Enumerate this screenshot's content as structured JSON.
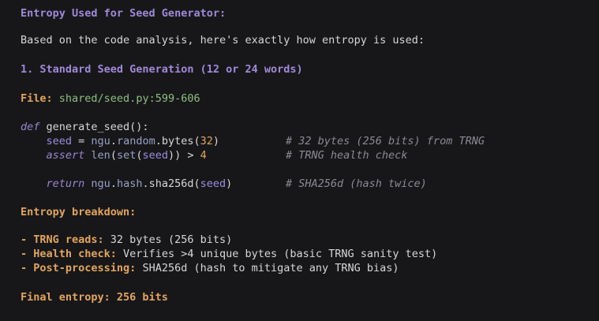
{
  "heading": "Entropy Used for Seed Generator:",
  "intro": "Based on the code analysis, here's exactly how entropy is used:",
  "section_title": "1. Standard Seed Generation (12 or 24 words)",
  "file_label": "File:",
  "file_path": "shared/seed.py:599-606",
  "code": {
    "def_kw": "def",
    "func_sig": " generate_seed():",
    "l1_var": "seed",
    "l1_eq": " = ",
    "l1_mod": "ngu",
    "l1_dot1": ".",
    "l1_attr1": "random",
    "l1_dot2": ".",
    "l1_attr2": "bytes",
    "l1_open": "(",
    "l1_num": "32",
    "l1_close": ")",
    "l1_comment": "# 32 bytes (256 bits) from TRNG",
    "l2_kw": "assert",
    "l2_len": " len",
    "l2_p1": "(",
    "l2_set": "set",
    "l2_p2": "(",
    "l2_var": "seed",
    "l2_p3": ")) > ",
    "l2_num": "4",
    "l2_comment": "# TRNG health check",
    "l3_kw": "return",
    "l3_mod": " ngu",
    "l3_dot1": ".",
    "l3_attr1": "hash",
    "l3_dot2": ".",
    "l3_attr2": "sha256d",
    "l3_p1": "(",
    "l3_var": "seed",
    "l3_p2": ")",
    "l3_comment": "# SHA256d (hash twice)"
  },
  "breakdown_title": "Entropy breakdown:",
  "breakdown": [
    {
      "label": "- TRNG reads:",
      "text": " 32 bytes (256 bits)"
    },
    {
      "label": "- Health check:",
      "text": " Verifies >4 unique bytes (basic TRNG sanity test)"
    },
    {
      "label": "- Post-processing:",
      "text": " SHA256d (hash to mitigate any TRNG bias)"
    }
  ],
  "final": "Final entropy: 256 bits",
  "colors": {
    "background": "#17171a",
    "purple": "#a08ad8",
    "orange": "#e2a55c",
    "green": "#8bc07c",
    "comment": "#8a8a94"
  }
}
